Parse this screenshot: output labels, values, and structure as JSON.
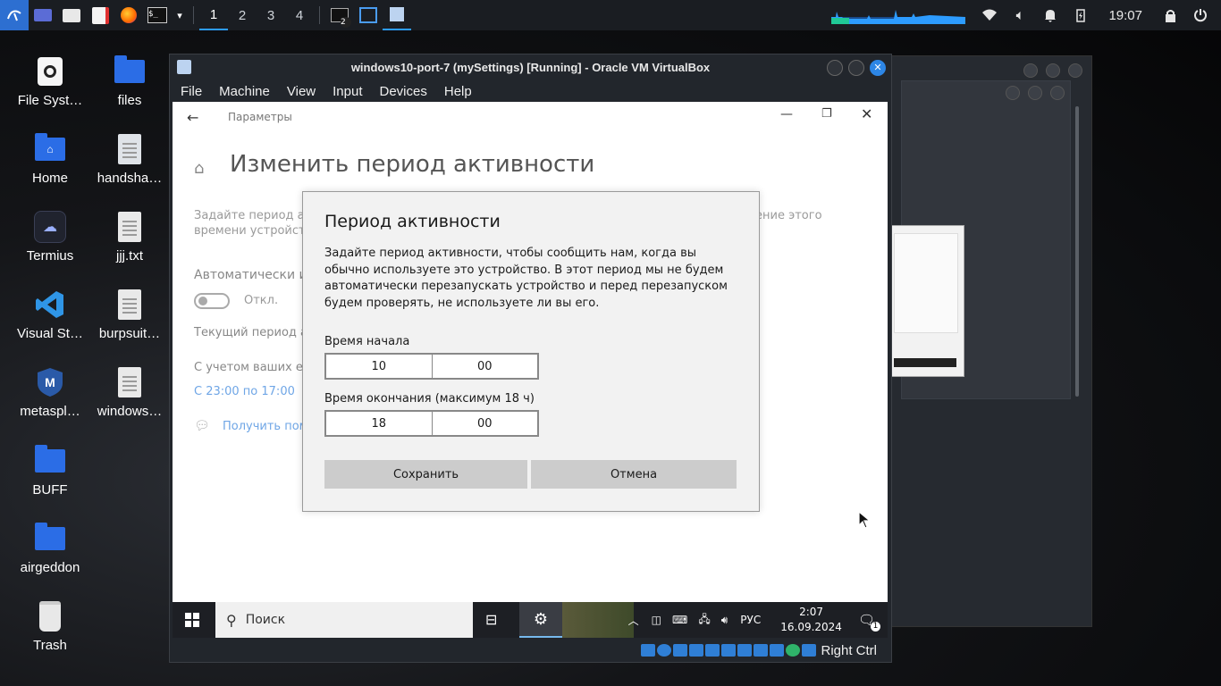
{
  "top_panel": {
    "workspaces": [
      "1",
      "2",
      "3",
      "4"
    ],
    "active_workspace": "1",
    "clock": "19:07",
    "terminal_badge": "2",
    "accent_color": "#2d9cff"
  },
  "desktop": {
    "icons": [
      {
        "label": "File Syst…",
        "icon": "disk-icon"
      },
      {
        "label": "files",
        "icon": "folder-icon"
      },
      {
        "label": "Home",
        "icon": "home-folder-icon"
      },
      {
        "label": "handsha…",
        "icon": "locked-file-icon"
      },
      {
        "label": "Termius",
        "icon": "termius-icon"
      },
      {
        "label": "jjj.txt",
        "icon": "text-file-icon"
      },
      {
        "label": "Visual St…",
        "icon": "vscode-icon"
      },
      {
        "label": "burpsuit…",
        "icon": "text-file-icon"
      },
      {
        "label": "metaspl…",
        "icon": "metasploit-icon"
      },
      {
        "label": "windows…",
        "icon": "text-file-icon"
      },
      {
        "label": "BUFF",
        "icon": "folder-icon"
      },
      {
        "label": "airgeddon",
        "icon": "folder-icon"
      },
      {
        "label": "Trash",
        "icon": "trash-icon"
      }
    ]
  },
  "vbox": {
    "title": "windows10-port-7 (mySettings) [Running] - Oracle VM VirtualBox",
    "menu": [
      "File",
      "Machine",
      "View",
      "Input",
      "Devices",
      "Help"
    ],
    "host_key": "Right Ctrl"
  },
  "settings": {
    "app_name": "Параметры",
    "page_title": "Изменить период активности",
    "desc_partial": "Задайте период ак",
    "desc_partial2": "времени устройст",
    "desc_right": "ение этого",
    "auto_label": "Автоматически изм",
    "toggle_state": "Откл.",
    "current_label": "Текущий период ак",
    "based_label": "С учетом ваших еж",
    "period_link": "С 23:00 по 17:00",
    "help_link": "Получить пом"
  },
  "dialog": {
    "title": "Период активности",
    "description": "Задайте период активности, чтобы сообщить нам, когда вы обычно используете это устройство. В этот период мы не будем автоматически перезапускать устройство и перед перезапуском будем проверять, не используете ли вы его.",
    "start_label": "Время начала",
    "start_hour": "10",
    "start_minute": "00",
    "end_label": "Время окончания (максимум 18 ч)",
    "end_hour": "18",
    "end_minute": "00",
    "save_label": "Сохранить",
    "cancel_label": "Отмена"
  },
  "guest_taskbar": {
    "search_placeholder": "Поиск",
    "language": "РУС",
    "time": "2:07",
    "date": "16.09.2024",
    "notification_count": "1"
  }
}
